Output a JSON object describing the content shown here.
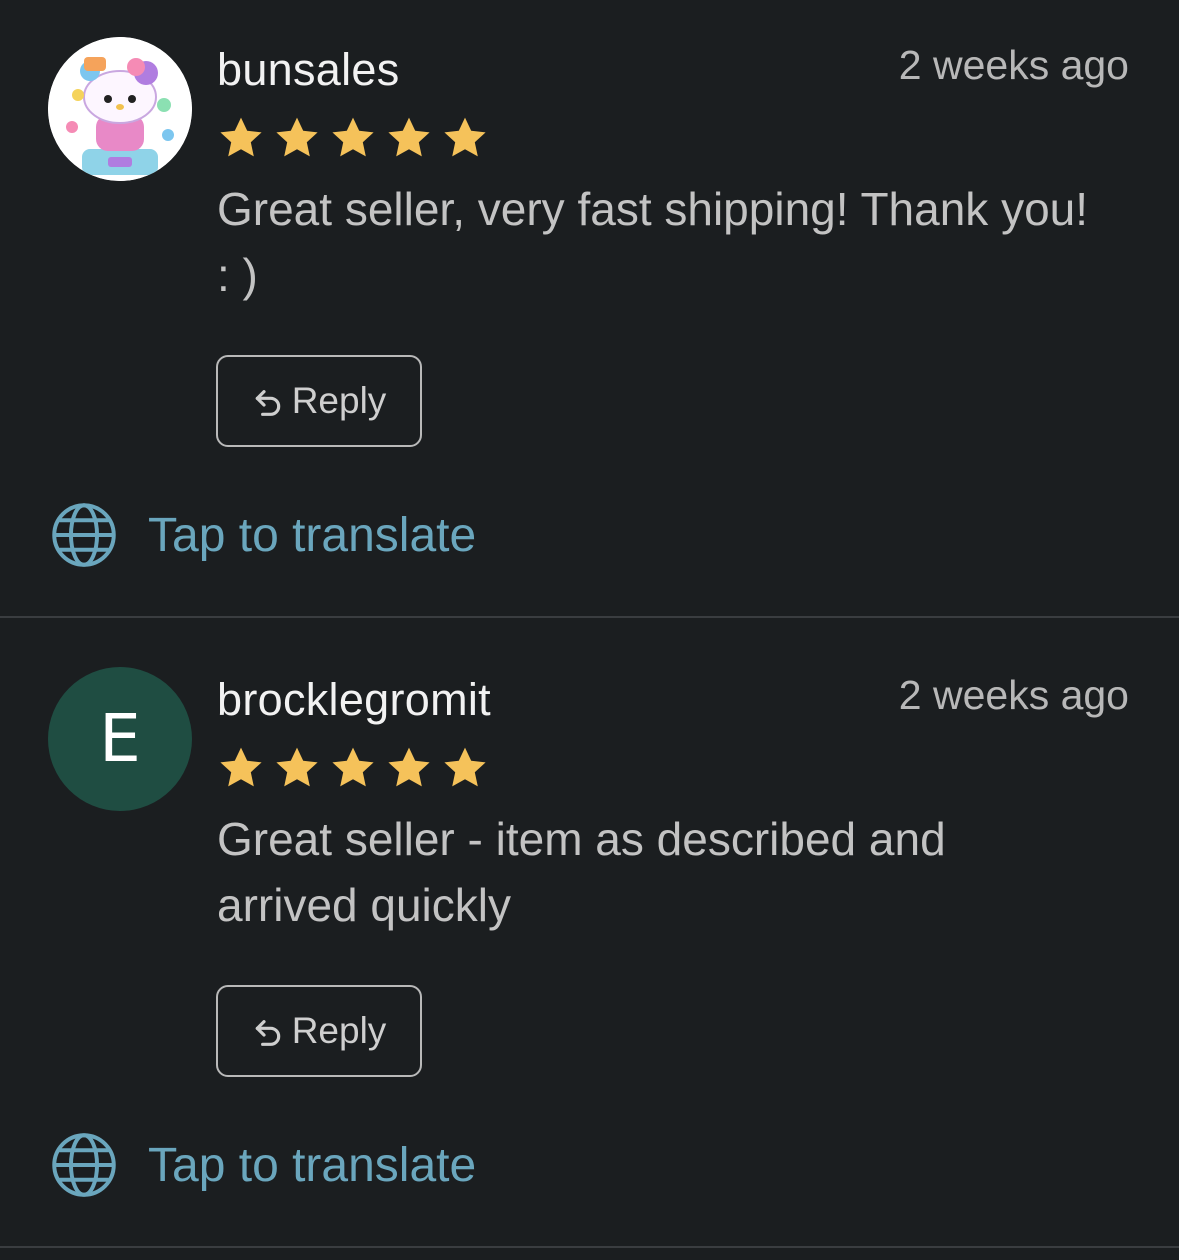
{
  "reviews": [
    {
      "username": "bunsales",
      "time": "2 weeks ago",
      "rating": 5,
      "comment": "Great seller, very fast shipping! Thank you! : )",
      "avatar_type": "image",
      "reply_label": "Reply",
      "translate_label": "Tap to translate"
    },
    {
      "username": "brocklegromit",
      "time": "2 weeks ago",
      "rating": 5,
      "comment": "Great seller - item as described and arrived quickly",
      "avatar_type": "letter",
      "avatar_letter": "E",
      "reply_label": "Reply",
      "translate_label": "Tap to translate"
    }
  ],
  "colors": {
    "background": "#1b1e20",
    "star": "#f5c25a",
    "translate_link": "#6aa6bd",
    "letter_avatar": "#1f4d42"
  },
  "icons": {
    "reply": "reply-arrow-icon",
    "translate": "globe-icon",
    "star": "star-icon"
  }
}
